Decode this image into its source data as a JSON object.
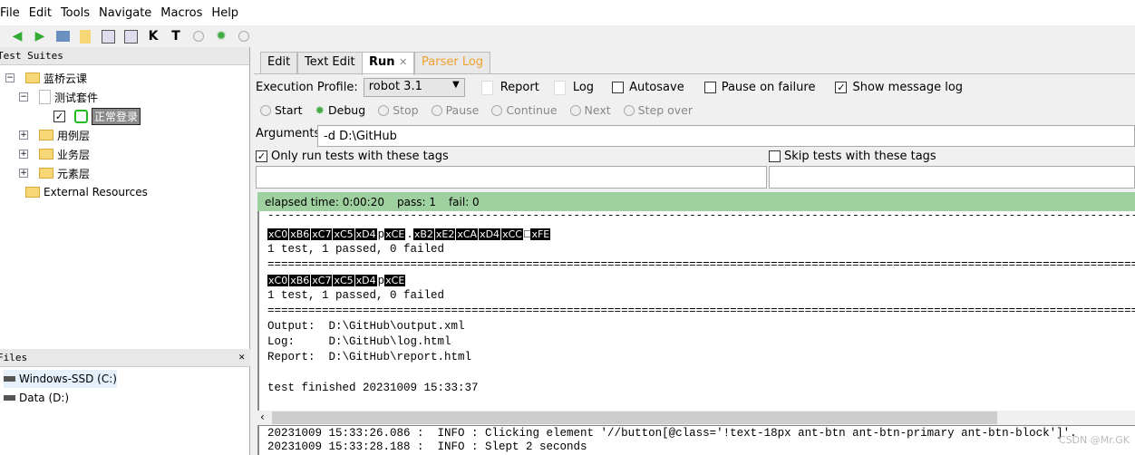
{
  "menu": [
    "File",
    "Edit",
    "Tools",
    "Navigate",
    "Macros",
    "Help"
  ],
  "toolbar": {
    "icons": [
      "arrow-left-icon",
      "arrow-right-icon",
      "open-icon",
      "folder-icon",
      "save-icon",
      "save-all-icon",
      "keyword-search-icon",
      "test-search-icon",
      "run-icon",
      "debug-icon",
      "stop-icon"
    ],
    "k": "K",
    "t": "T"
  },
  "test_suites": {
    "title": "Test Suites",
    "root": "蓝桥云课",
    "suite": "测试套件",
    "test": "正常登录",
    "folders": [
      "用例层",
      "业务层",
      "元素层"
    ],
    "external": "External Resources"
  },
  "files": {
    "title": "Files",
    "items": [
      "Windows-SSD (C:)",
      "Data (D:)"
    ],
    "close": "✕"
  },
  "tabs": [
    {
      "label": "Edit"
    },
    {
      "label": "Text Edit"
    },
    {
      "label": "Run",
      "active": true,
      "close": "✕"
    },
    {
      "label": "Parser Log",
      "color": "#f0a030"
    }
  ],
  "run": {
    "profile_label": "Execution Profile:",
    "profile_value": "robot 3.1",
    "report": "Report",
    "log": "Log",
    "autosave": "Autosave",
    "pause_on_failure": "Pause on failure",
    "show_message_log": "Show message log",
    "show_message_log_checked": true,
    "buttons": [
      "Start",
      "Debug",
      "Stop",
      "Pause",
      "Continue",
      "Next",
      "Step over"
    ],
    "arguments_label": "Arguments:",
    "arguments_value": "-d D:\\GitHub",
    "only_run_tags": "Only run tests with these tags",
    "only_run_checked": true,
    "skip_tags": "Skip tests with these tags"
  },
  "status": {
    "elapsed": "elapsed time: 0:00:20",
    "pass": "pass: 1",
    "fail": "fail: 0",
    "color": "#9fd09f"
  },
  "output": {
    "line1_tokens": [
      "xC0",
      "xB6",
      "xC7",
      "xC5",
      "xD4",
      "p",
      "xCE",
      ".",
      "xB2",
      "xE2",
      "xCA",
      "xD4",
      "xCC",
      "□",
      "xFE"
    ],
    "result1": "1 test, 1 passed, 0 failed",
    "line2_tokens": [
      "xC0",
      "xB6",
      "xC7",
      "xC5",
      "xD4",
      "p",
      "xCE"
    ],
    "result2": "1 test, 1 passed, 0 failed",
    "output_line": "Output:  D:\\GitHub\\output.xml",
    "log_line": "Log:     D:\\GitHub\\log.html",
    "report_line": "Report:  D:\\GitHub\\report.html",
    "finished": "test finished 20231009 15:33:37"
  },
  "message_log": [
    "20231009 15:33:26.086 :  INFO : Clicking element '//button[@class='!text-18px ant-btn ant-btn-primary ant-btn-block']'.",
    "20231009 15:33:28.188 :  INFO : Slept 2 seconds"
  ],
  "watermark": "CSDN @Mr.GK"
}
